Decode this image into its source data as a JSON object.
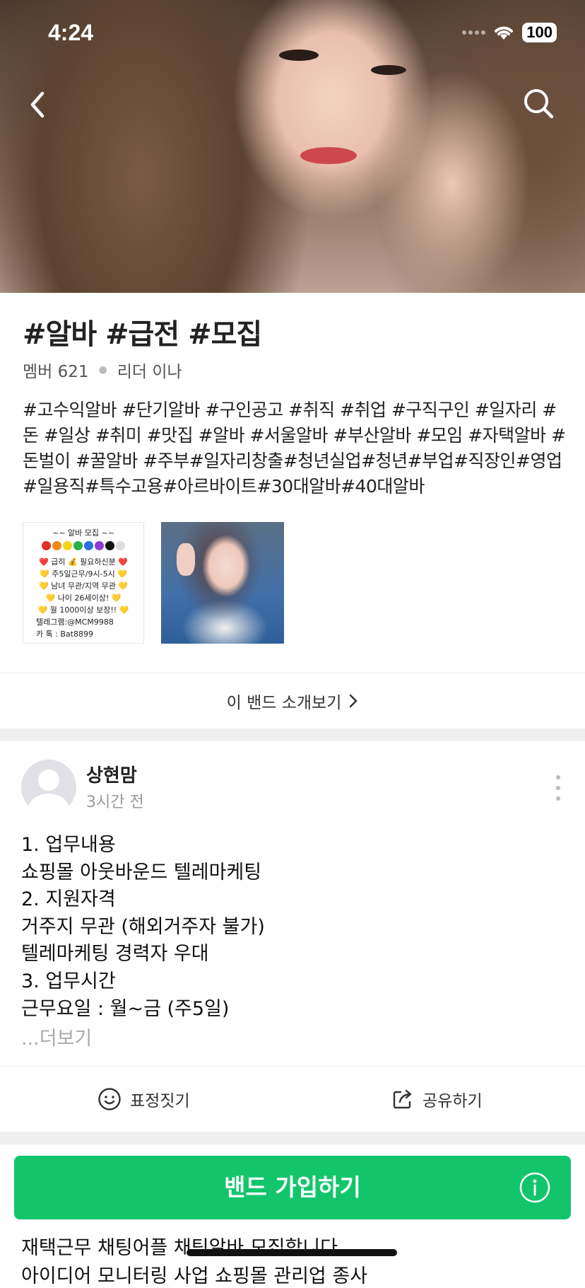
{
  "status_bar": {
    "time": "4:24",
    "battery": "100"
  },
  "band": {
    "title": "#알바 #급전 #모집",
    "member_label": "멤버 621",
    "leader_label": "리더 이나",
    "description": "#고수익알바 #단기알바 #구인공고 #취직 #취업 #구직구인 #일자리 #돈 #일상 #취미 #맛집 #알바 #서울알바 #부산알바 #모임 #자택알바 #돈벌이 #꿀알바 #주부#일자리창출#청년실업#청년#부업#직장인#영업#일용직#특수고용#아르바이트#30대알바#40대알바",
    "thumb1_lines": {
      "header": "~~ 알바 모집 ~~",
      "line1": "❤️ 급히 💰 필요하신분 ❤️",
      "line2": "💛 주5일근무/9시-5시 💛",
      "line3": "💛 남녀 무관/지역 무관 💛",
      "line4": "💛   나이 26세이상!   💛",
      "line5": "💛 월 1000이상 보장!! 💛",
      "line6": "텔레그램:@MCM9988",
      "line7": "카  톡 : Bat8899"
    },
    "intro_link": "이 밴드 소개보기"
  },
  "post": {
    "author": "상현맘",
    "time": "3시간 전",
    "lines": [
      "1. 업무내용",
      "쇼핑몰 아웃바운드 텔레마케팅",
      "2. 지원자격",
      "거주지 무관 (해외거주자 불가)",
      "텔레마케팅 경력자 우대",
      "3. 업무시간",
      "근무요일 : 월~금 (주5일)"
    ],
    "more": "...더보기",
    "actions": {
      "emote": "표정짓기",
      "share": "공유하기"
    }
  },
  "join_button": "밴드 가입하기",
  "next_post": {
    "line1": "재택근무 채팅어플 채팅알바 모집합니다",
    "line2": "아이디어 모니터링 사업 쇼핑몰 관리업 종사"
  },
  "colors": {
    "accent": "#12c56b",
    "background": "#ffffff",
    "separator": "#efefef"
  },
  "icons": [
    "back-arrow-icon",
    "search-icon",
    "more-vertical-icon",
    "smile-icon",
    "share-icon",
    "info-icon",
    "chevron-right-icon"
  ]
}
